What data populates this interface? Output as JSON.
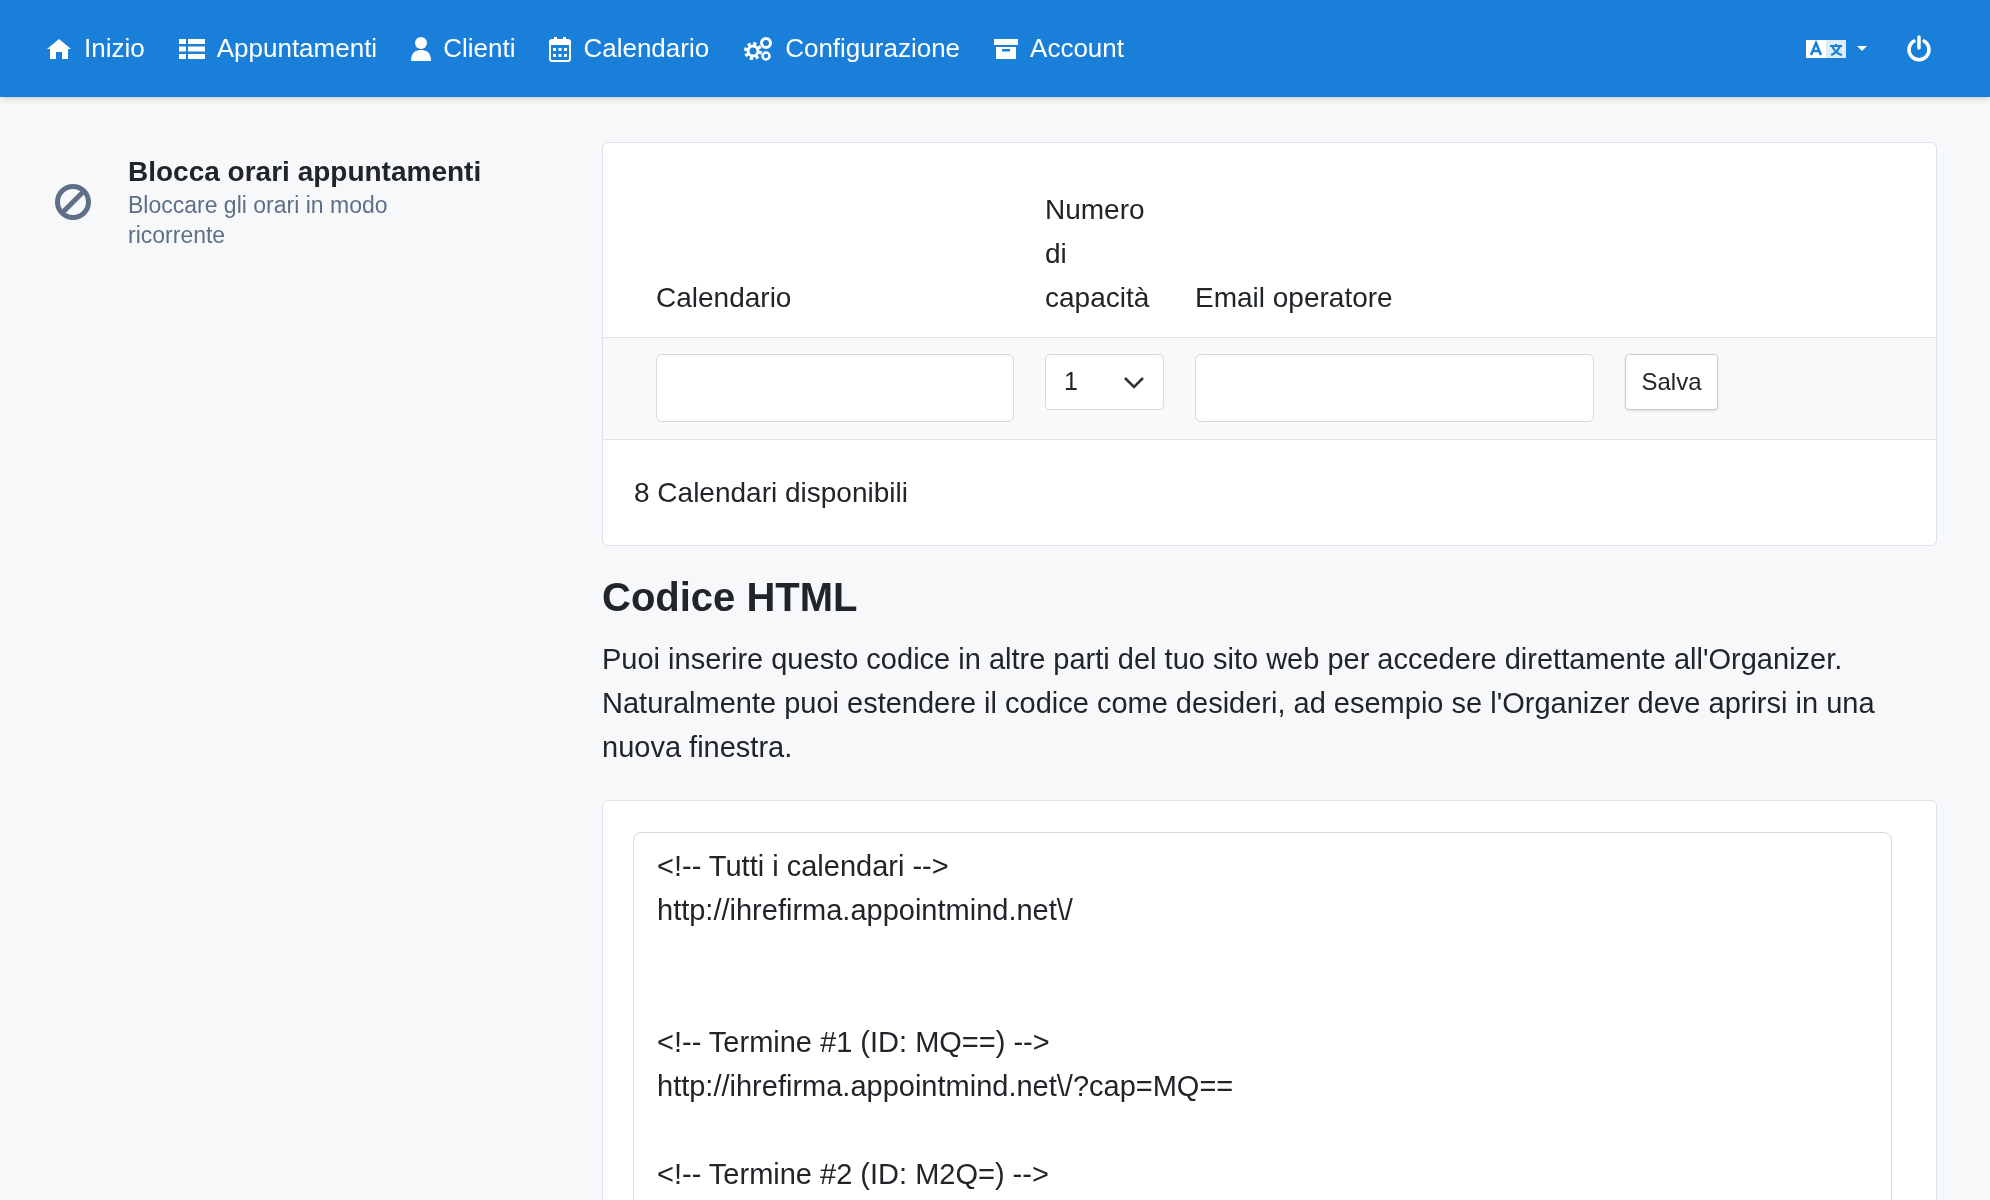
{
  "navbar": {
    "items": [
      {
        "label": "Inizio"
      },
      {
        "label": "Appuntamenti"
      },
      {
        "label": "Clienti"
      },
      {
        "label": "Calendario"
      },
      {
        "label": "Configurazione"
      },
      {
        "label": "Account"
      }
    ]
  },
  "sidebar": {
    "items": [
      {
        "title": "Blocca orari appuntamenti",
        "subtitle": "Bloccare gli orari in modo ricorrente"
      }
    ]
  },
  "add_calendar": {
    "columns": [
      "Calendario",
      "Numero di capacità",
      "Email operatore"
    ],
    "capacity": {
      "value": "1"
    },
    "save_button": "Salva",
    "footer": "8 Calendari disponibili"
  },
  "html_code": {
    "title": "Codice HTML",
    "description": "Puoi inserire questo codice in altre parti del tuo sito web per accedere direttamente all'Organizer. Naturalmente puoi estendere il codice come desideri, ad esempio se l'Organizer deve aprirsi in una nuova finestra.",
    "code": "<!-- Tutti i calendari -->\nhttp://ihrefirma.appointmind.net\\/\n\n\n<!-- Termine #1 (ID: MQ==) -->\nhttp://ihrefirma.appointmind.net\\/?cap=MQ==\n\n<!-- Termine #2 (ID: M2Q=) -->"
  }
}
